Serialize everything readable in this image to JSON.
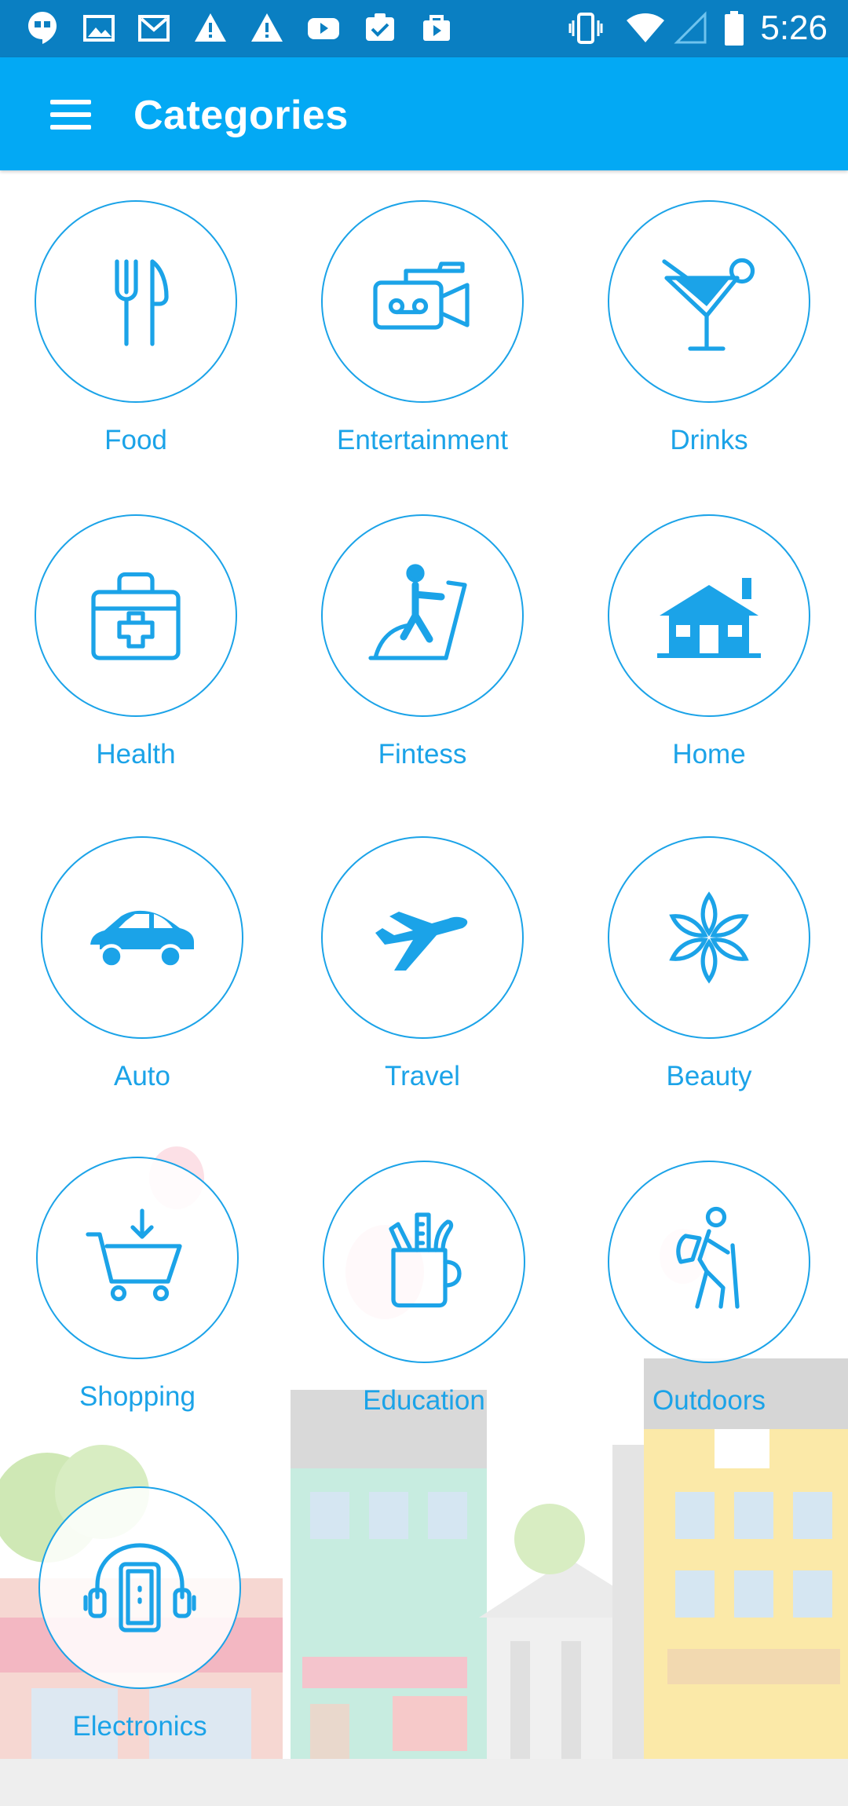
{
  "status_bar": {
    "time": "5:26",
    "left_icons": [
      "hangouts-icon",
      "image-icon",
      "gmail-icon",
      "warning-icon",
      "warning-icon",
      "youtube-icon",
      "clipboard-check-icon",
      "play-store-icon"
    ],
    "right_icons": [
      "vibrate-icon",
      "wifi-icon",
      "signal-icon",
      "battery-icon"
    ]
  },
  "app_bar": {
    "title": "Categories",
    "menu_icon": "hamburger-icon"
  },
  "colors": {
    "status_bar": "#0a7fc2",
    "app_bar": "#03a9f4",
    "accent": "#1ba3e8",
    "background": "#ffffff"
  },
  "categories": [
    {
      "label": "Food",
      "icon": "fork-knife-icon"
    },
    {
      "label": "Entertainment",
      "icon": "video-camera-icon"
    },
    {
      "label": "Drinks",
      "icon": "cocktail-icon"
    },
    {
      "label": "Health",
      "icon": "first-aid-kit-icon"
    },
    {
      "label": "Fintess",
      "icon": "treadmill-icon"
    },
    {
      "label": "Home",
      "icon": "house-icon"
    },
    {
      "label": "Auto",
      "icon": "car-icon"
    },
    {
      "label": "Travel",
      "icon": "airplane-icon"
    },
    {
      "label": "Beauty",
      "icon": "flower-icon"
    },
    {
      "label": "Shopping",
      "icon": "shopping-cart-icon"
    },
    {
      "label": "Education",
      "icon": "pencil-cup-icon"
    },
    {
      "label": "Outdoors",
      "icon": "hiker-icon"
    },
    {
      "label": "Electronics",
      "icon": "headphones-phone-icon"
    }
  ]
}
